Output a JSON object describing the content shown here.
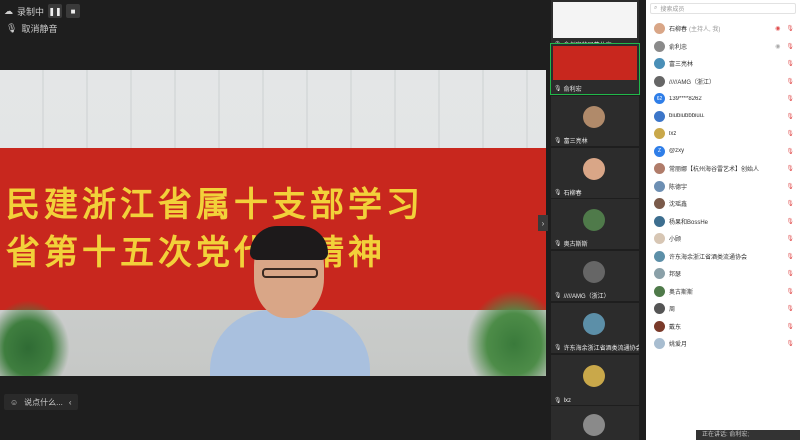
{
  "topbar": {
    "recording_label": "录制中",
    "pause_icon": "pause-icon",
    "stop_icon": "stop-icon"
  },
  "mute_toggle": {
    "label": "取消静音"
  },
  "banner": {
    "line1": "民建浙江省属十支部学习",
    "line2": "省第十五次党代会精神"
  },
  "bottom_bar": {
    "label": "说点什么..."
  },
  "thumbnails": [
    {
      "name": "俞剑安的屏幕共享"
    },
    {
      "name": "俞利宏"
    },
    {
      "name": "富三亮林"
    },
    {
      "name": "石柳春"
    },
    {
      "name": "奥古斯斯"
    },
    {
      "name": "/////AMG（浙江）"
    },
    {
      "name": "许东海余浙江省酒类流通协会"
    },
    {
      "name": "lxz"
    },
    {
      "name": ""
    }
  ],
  "panel": {
    "search_placeholder": "搜索成员",
    "participants": [
      {
        "name": "石柳春",
        "sub": "(主持人, 我)",
        "avatar_color": "#d9a687",
        "initial": ""
      },
      {
        "name": "俞利忠",
        "sub": "",
        "avatar_color": "#8a8a8a",
        "initial": ""
      },
      {
        "name": "富三亮林",
        "sub": "",
        "avatar_color": "#4a8fb7",
        "initial": ""
      },
      {
        "name": "/////AMG（浙江）",
        "sub": "",
        "avatar_color": "#666",
        "initial": ""
      },
      {
        "name": "139****8262",
        "sub": "",
        "avatar_color": "#2f7ee8",
        "initial": "62"
      },
      {
        "name": "biubiubbbiuu.",
        "sub": "",
        "avatar_color": "#3c76c9",
        "initial": ""
      },
      {
        "name": "lxz",
        "sub": "",
        "avatar_color": "#c9a84a",
        "initial": ""
      },
      {
        "name": "@zxy",
        "sub": "",
        "avatar_color": "#2f7ee8",
        "initial": "Z"
      },
      {
        "name": "常丽娜【杭州海谷雷艺术】创始人",
        "sub": "",
        "avatar_color": "#b07c6a",
        "initial": ""
      },
      {
        "name": "陈德宇",
        "sub": "",
        "avatar_color": "#6d8fb3",
        "initial": ""
      },
      {
        "name": "沈瑶鑫",
        "sub": "",
        "avatar_color": "#7a5a4a",
        "initial": ""
      },
      {
        "name": "杨果和BossHe",
        "sub": "",
        "avatar_color": "#3d6e8f",
        "initial": ""
      },
      {
        "name": "小顾",
        "sub": "",
        "avatar_color": "#d7c6b4",
        "initial": ""
      },
      {
        "name": "许东海余浙江省酒类流通协会",
        "sub": "",
        "avatar_color": "#5c8fa8",
        "initial": ""
      },
      {
        "name": "邦瑟",
        "sub": "",
        "avatar_color": "#8aa0a8",
        "initial": ""
      },
      {
        "name": "奥古斯斯",
        "sub": "",
        "avatar_color": "#4f7a4a",
        "initial": ""
      },
      {
        "name": "周",
        "sub": "",
        "avatar_color": "#555",
        "initial": ""
      },
      {
        "name": "戴东",
        "sub": "",
        "avatar_color": "#7a3a2a",
        "initial": ""
      },
      {
        "name": "姚爱月",
        "sub": "",
        "avatar_color": "#a8bdd0",
        "initial": ""
      }
    ]
  },
  "notice": {
    "text": "正在讲话: 俞利宏;"
  },
  "colors": {
    "accent": "#21b84a",
    "banner_red": "#c8271e",
    "banner_text": "#f2d13a",
    "muted_red": "#e04a4a"
  }
}
